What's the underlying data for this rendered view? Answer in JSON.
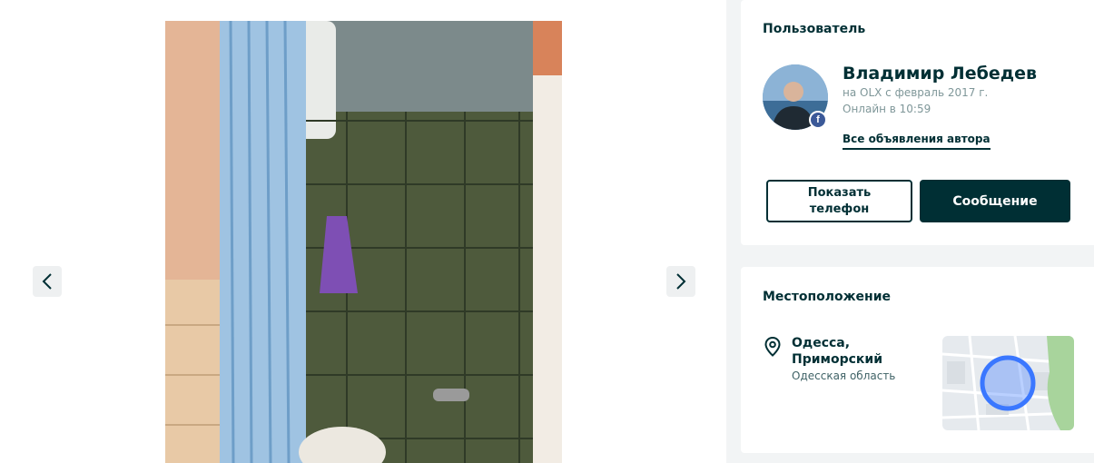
{
  "gallery": {
    "prev_icon": "chevron-left-icon",
    "next_icon": "chevron-right-icon"
  },
  "user": {
    "section_title": "Пользователь",
    "name": "Владимир Лебедев",
    "member_since": "на OLX с февраль 2017 г.",
    "online_status": "Онлайн в 10:59",
    "all_ads_link": "Все объявления автора",
    "social_badge": "f",
    "show_phone_button": "Показать телефон",
    "message_button": "Сообщение"
  },
  "location": {
    "section_title": "Местоположение",
    "city": "Одесса, Приморский",
    "region": "Одесская область",
    "pin_icon": "location-pin-icon"
  },
  "colors": {
    "primary": "#002f34",
    "muted": "#7f9799",
    "background": "#f2f4f5",
    "map_circle": "#3a77ff"
  }
}
